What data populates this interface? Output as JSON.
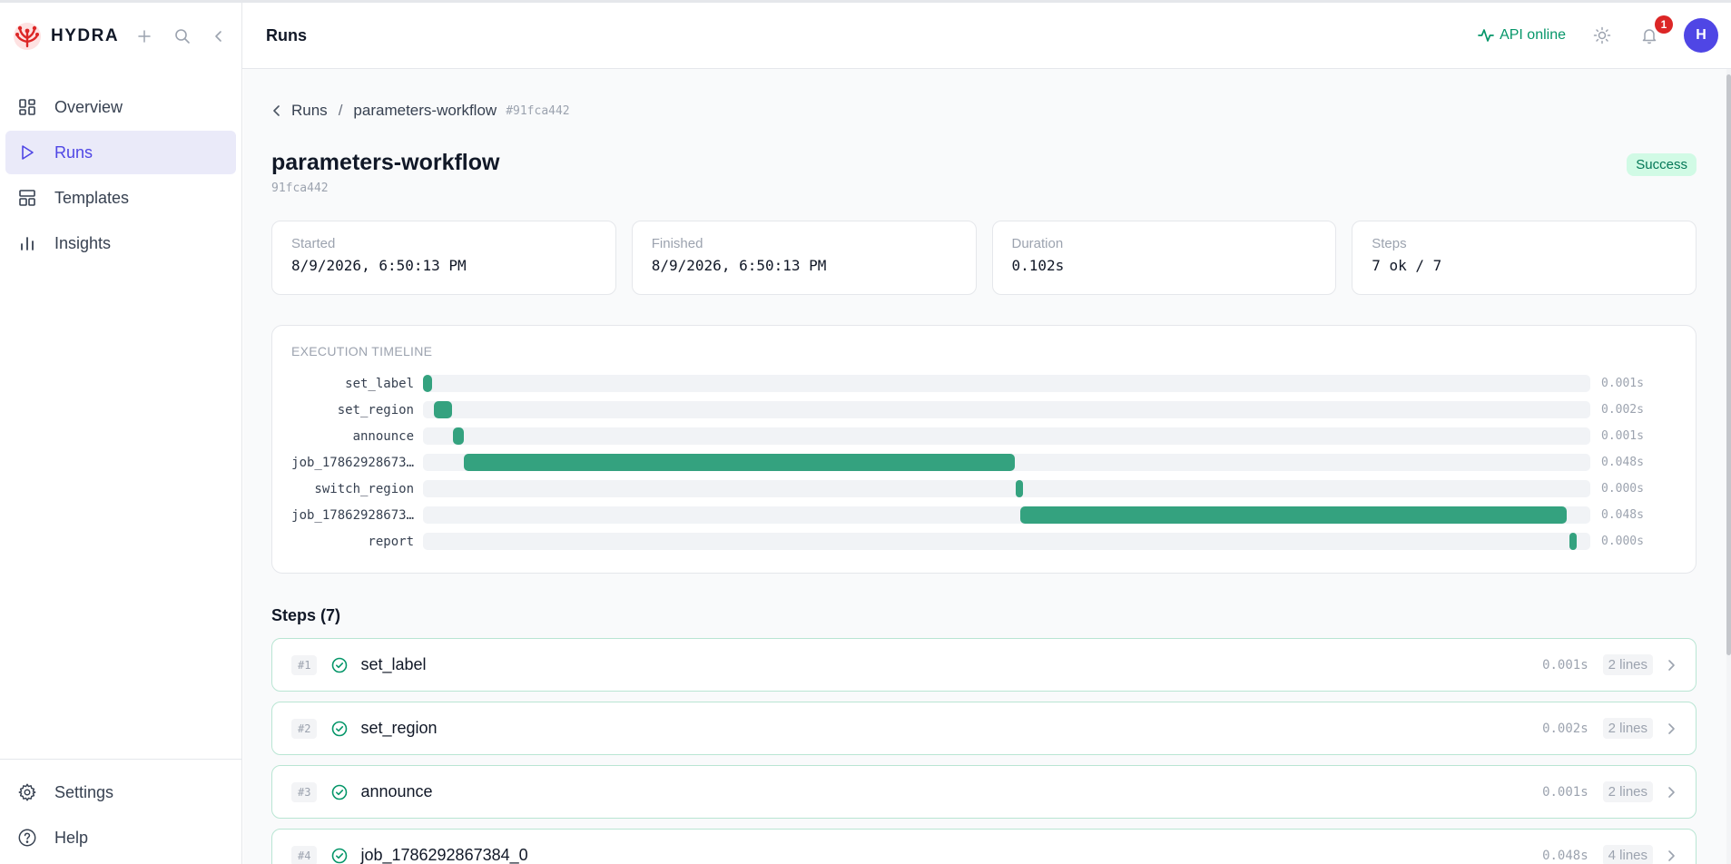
{
  "app": {
    "name": "HYDRA"
  },
  "sidebar": {
    "items": [
      {
        "label": "Overview",
        "icon": "grid-icon"
      },
      {
        "label": "Runs",
        "icon": "play-icon",
        "active": true
      },
      {
        "label": "Templates",
        "icon": "layout-icon"
      },
      {
        "label": "Insights",
        "icon": "bar-chart-icon"
      }
    ],
    "bottom": [
      {
        "label": "Settings",
        "icon": "gear-icon"
      },
      {
        "label": "Help",
        "icon": "help-circle-icon"
      }
    ]
  },
  "header": {
    "title": "Runs",
    "api_status": "API online",
    "notifications": "1",
    "avatar": "H"
  },
  "breadcrumb": {
    "parent": "Runs",
    "sep": "/",
    "current": "parameters-workflow",
    "hash": "#91fca442"
  },
  "run": {
    "title": "parameters-workflow",
    "id": "91fca442",
    "status": "Success",
    "stats": [
      {
        "label": "Started",
        "value": "8/9/2026, 6:50:13 PM"
      },
      {
        "label": "Finished",
        "value": "8/9/2026, 6:50:13 PM"
      },
      {
        "label": "Duration",
        "value": "0.102s"
      },
      {
        "label": "Steps",
        "value": "7 ok / 7"
      }
    ]
  },
  "timeline": {
    "heading": "EXECUTION TIMELINE",
    "rows": [
      {
        "name": "set_label",
        "start": 0.0,
        "end": 0.008,
        "duration": "0.001s"
      },
      {
        "name": "set_region",
        "start": 0.009,
        "end": 0.025,
        "duration": "0.002s"
      },
      {
        "name": "announce",
        "start": 0.026,
        "end": 0.035,
        "duration": "0.001s"
      },
      {
        "name": "job_17862928673…",
        "start": 0.035,
        "end": 0.507,
        "duration": "0.048s"
      },
      {
        "name": "switch_region",
        "start": 0.508,
        "end": 0.512,
        "duration": "0.000s"
      },
      {
        "name": "job_17862928673…",
        "start": 0.512,
        "end": 0.98,
        "duration": "0.048s"
      },
      {
        "name": "report",
        "start": 0.982,
        "end": 0.987,
        "duration": "0.000s"
      }
    ]
  },
  "steps": {
    "heading": "Steps (7)",
    "items": [
      {
        "num": "#1",
        "name": "set_label",
        "duration": "0.001s",
        "lines": "2 lines"
      },
      {
        "num": "#2",
        "name": "set_region",
        "duration": "0.002s",
        "lines": "2 lines"
      },
      {
        "num": "#3",
        "name": "announce",
        "duration": "0.001s",
        "lines": "2 lines"
      },
      {
        "num": "#4",
        "name": "job_1786292867384_0",
        "duration": "0.048s",
        "lines": "4 lines"
      }
    ]
  },
  "colors": {
    "accent": "#4f46e5",
    "success": "#059669",
    "bar": "#34a27f"
  }
}
